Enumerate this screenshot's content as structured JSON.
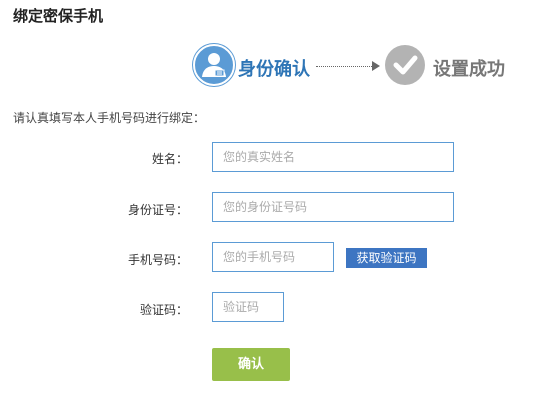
{
  "page": {
    "title": "绑定密保手机",
    "instruction": "请认真填写本人手机号码进行绑定："
  },
  "steps": [
    {
      "label": "身份确认",
      "icon": "user-card-icon",
      "active": true,
      "color": "#5b9bd5"
    },
    {
      "label": "设置成功",
      "icon": "checkmark-icon",
      "active": false,
      "color": "#b3b3b3"
    }
  ],
  "form": {
    "name": {
      "label": "姓名：",
      "placeholder": "您的真实姓名",
      "value": ""
    },
    "id_number": {
      "label": "身份证号：",
      "placeholder": "您的身份证号码",
      "value": ""
    },
    "phone": {
      "label": "手机号码：",
      "placeholder": "您的手机号码",
      "value": ""
    },
    "code": {
      "label": "验证码：",
      "placeholder": "验证码",
      "value": ""
    },
    "get_code_label": "获取验证码",
    "confirm_label": "确认"
  },
  "colors": {
    "accent": "#5b9bd5",
    "button_blue": "#3d75c2",
    "button_green": "#98bf4a"
  }
}
